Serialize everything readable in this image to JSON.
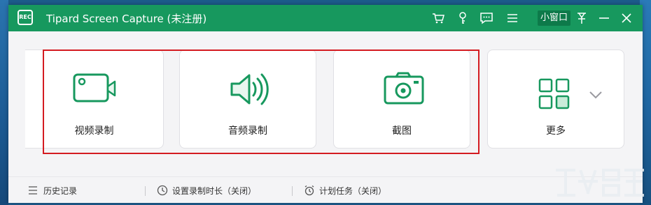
{
  "window": {
    "title": "Tipard Screen Capture (未注册)",
    "logo_text": "REC",
    "mini_mode_label": "小窗口"
  },
  "titlebar_icons": [
    "cart-icon",
    "key-icon",
    "feedback-icon",
    "menu-icon",
    "pin-icon",
    "minimize-icon",
    "close-icon"
  ],
  "cards": [
    {
      "label": "视频录制",
      "icon": "video-camera-icon"
    },
    {
      "label": "音频录制",
      "icon": "speaker-icon"
    },
    {
      "label": "截图",
      "icon": "camera-icon"
    },
    {
      "label": "更多",
      "icon": "grid-icon"
    }
  ],
  "status": {
    "history": "历史记录",
    "timer": "设置录制时长（关闭）",
    "schedule": "计划任务（关闭）"
  },
  "colors": {
    "brand": "#17985e",
    "highlight_border": "#d41b21"
  }
}
